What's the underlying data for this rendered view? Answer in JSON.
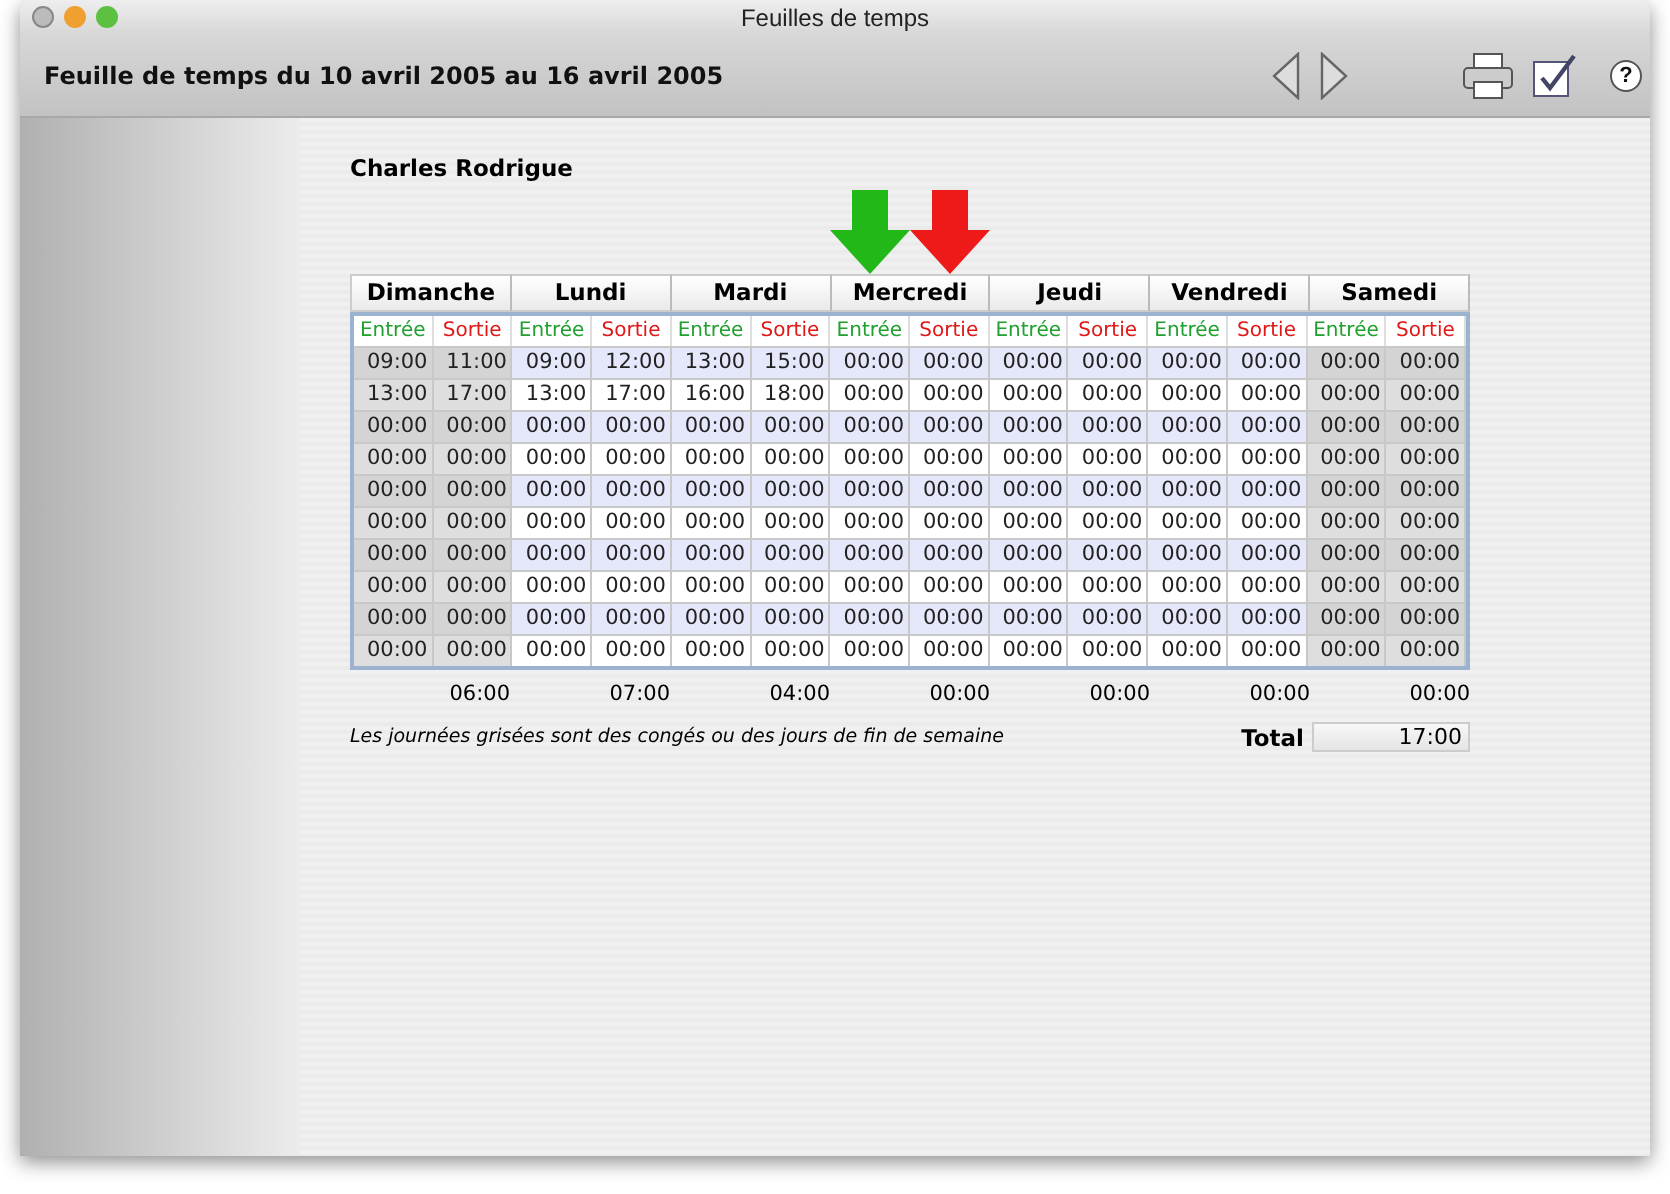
{
  "window": {
    "title": "Feuilles de temps"
  },
  "toolbar": {
    "title": "Feuille de temps du 10 avril 2005 au 16 avril 2005",
    "help": "?"
  },
  "employee": "Charles Rodrigue",
  "days": [
    {
      "name": "Dimanche",
      "off": true,
      "headers": [
        "Entrée",
        "Sortie"
      ],
      "times": [
        [
          "09:00",
          "11:00"
        ],
        [
          "13:00",
          "17:00"
        ],
        [
          "00:00",
          "00:00"
        ],
        [
          "00:00",
          "00:00"
        ],
        [
          "00:00",
          "00:00"
        ],
        [
          "00:00",
          "00:00"
        ],
        [
          "00:00",
          "00:00"
        ],
        [
          "00:00",
          "00:00"
        ],
        [
          "00:00",
          "00:00"
        ],
        [
          "00:00",
          "00:00"
        ]
      ],
      "total": "06:00"
    },
    {
      "name": "Lundi",
      "off": false,
      "headers": [
        "Entrée",
        "Sortie"
      ],
      "times": [
        [
          "09:00",
          "12:00"
        ],
        [
          "13:00",
          "17:00"
        ],
        [
          "00:00",
          "00:00"
        ],
        [
          "00:00",
          "00:00"
        ],
        [
          "00:00",
          "00:00"
        ],
        [
          "00:00",
          "00:00"
        ],
        [
          "00:00",
          "00:00"
        ],
        [
          "00:00",
          "00:00"
        ],
        [
          "00:00",
          "00:00"
        ],
        [
          "00:00",
          "00:00"
        ]
      ],
      "total": "07:00"
    },
    {
      "name": "Mardi",
      "off": false,
      "headers": [
        "Entrée",
        "Sortie"
      ],
      "times": [
        [
          "13:00",
          "15:00"
        ],
        [
          "16:00",
          "18:00"
        ],
        [
          "00:00",
          "00:00"
        ],
        [
          "00:00",
          "00:00"
        ],
        [
          "00:00",
          "00:00"
        ],
        [
          "00:00",
          "00:00"
        ],
        [
          "00:00",
          "00:00"
        ],
        [
          "00:00",
          "00:00"
        ],
        [
          "00:00",
          "00:00"
        ],
        [
          "00:00",
          "00:00"
        ]
      ],
      "total": "04:00"
    },
    {
      "name": "Mercredi",
      "off": false,
      "headers": [
        "Entrée",
        "Sortie"
      ],
      "times": [
        [
          "00:00",
          "00:00"
        ],
        [
          "00:00",
          "00:00"
        ],
        [
          "00:00",
          "00:00"
        ],
        [
          "00:00",
          "00:00"
        ],
        [
          "00:00",
          "00:00"
        ],
        [
          "00:00",
          "00:00"
        ],
        [
          "00:00",
          "00:00"
        ],
        [
          "00:00",
          "00:00"
        ],
        [
          "00:00",
          "00:00"
        ],
        [
          "00:00",
          "00:00"
        ]
      ],
      "total": "00:00"
    },
    {
      "name": "Jeudi",
      "off": false,
      "headers": [
        "Entrée",
        "Sortie"
      ],
      "times": [
        [
          "00:00",
          "00:00"
        ],
        [
          "00:00",
          "00:00"
        ],
        [
          "00:00",
          "00:00"
        ],
        [
          "00:00",
          "00:00"
        ],
        [
          "00:00",
          "00:00"
        ],
        [
          "00:00",
          "00:00"
        ],
        [
          "00:00",
          "00:00"
        ],
        [
          "00:00",
          "00:00"
        ],
        [
          "00:00",
          "00:00"
        ],
        [
          "00:00",
          "00:00"
        ]
      ],
      "total": "00:00"
    },
    {
      "name": "Vendredi",
      "off": false,
      "headers": [
        "Entrée",
        "Sortie"
      ],
      "times": [
        [
          "00:00",
          "00:00"
        ],
        [
          "00:00",
          "00:00"
        ],
        [
          "00:00",
          "00:00"
        ],
        [
          "00:00",
          "00:00"
        ],
        [
          "00:00",
          "00:00"
        ],
        [
          "00:00",
          "00:00"
        ],
        [
          "00:00",
          "00:00"
        ],
        [
          "00:00",
          "00:00"
        ],
        [
          "00:00",
          "00:00"
        ],
        [
          "00:00",
          "00:00"
        ]
      ],
      "total": "00:00"
    },
    {
      "name": "Samedi",
      "off": true,
      "headers": [
        "Entrée",
        "Sortie"
      ],
      "times": [
        [
          "00:00",
          "00:00"
        ],
        [
          "00:00",
          "00:00"
        ],
        [
          "00:00",
          "00:00"
        ],
        [
          "00:00",
          "00:00"
        ],
        [
          "00:00",
          "00:00"
        ],
        [
          "00:00",
          "00:00"
        ],
        [
          "00:00",
          "00:00"
        ],
        [
          "00:00",
          "00:00"
        ],
        [
          "00:00",
          "00:00"
        ],
        [
          "00:00",
          "00:00"
        ]
      ],
      "total": "00:00"
    }
  ],
  "note": "Les journées grisées sont des congés ou des jours de fin de semaine",
  "total": {
    "label": "Total",
    "value": "17:00"
  }
}
